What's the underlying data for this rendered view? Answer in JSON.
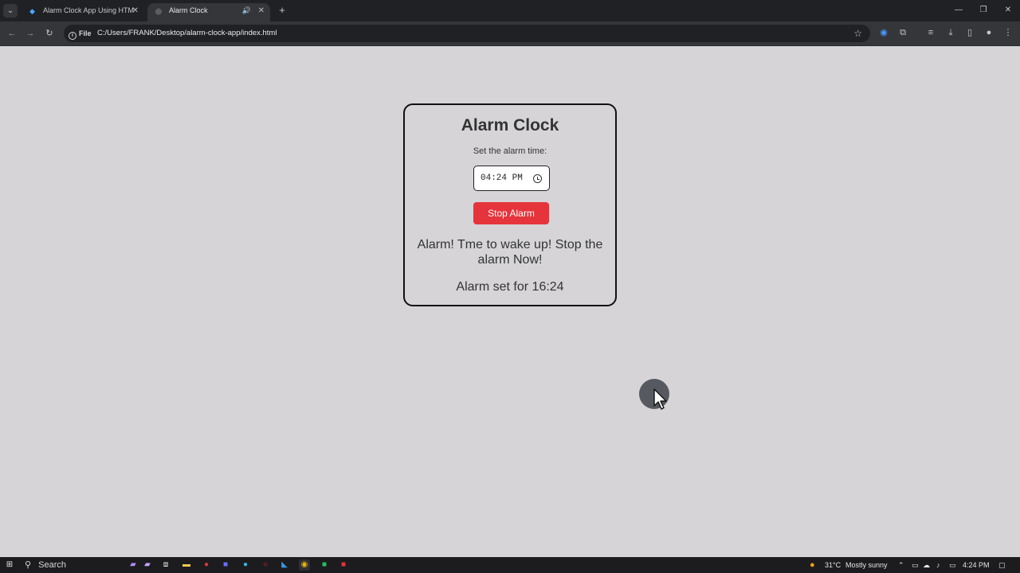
{
  "browser": {
    "tabs": [
      {
        "label": "Alarm Clock App Using HTML, C",
        "favicon": "droplet-icon",
        "active": false
      },
      {
        "label": "Alarm Clock",
        "favicon": "globe-icon",
        "active": true,
        "audio": true
      }
    ],
    "new_tab_label": "+",
    "address": {
      "chip_label": "File",
      "url": "C:/Users/FRANK/Desktop/alarm-clock-app/index.html"
    }
  },
  "app": {
    "title": "Alarm Clock",
    "set_label": "Set the alarm time:",
    "time_value": "04:24 PM",
    "stop_label": "Stop Alarm",
    "alarm_message": "Alarm! Tme to wake up! Stop the alarm Now!",
    "alarm_status": "Alarm set for 16:24"
  },
  "taskbar": {
    "search_label": "Search",
    "weather_temp": "31°C",
    "weather_desc": "Mostly sunny",
    "time": "4:24 PM"
  },
  "colors": {
    "page_bg": "#d6d4d7",
    "stop_button": "#e5343b",
    "browser_chrome": "#35363a"
  }
}
